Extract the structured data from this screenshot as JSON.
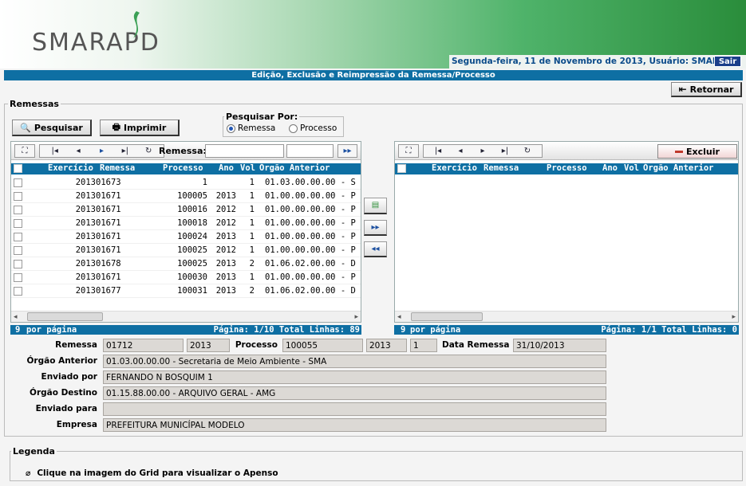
{
  "app": {
    "logo": "SMARAPD",
    "user_bar": "Segunda-feira, 11 de Novembro de 2013, Usuário: SMAR",
    "logout_label": "Sair",
    "title": "Edição, Exclusão e Reimpressão da Remessa/Processo",
    "return_label": "Retornar"
  },
  "remessas": {
    "legend": "Remessas",
    "search_label": "Pesquisar",
    "print_label": "Imprimir",
    "search_by": {
      "legend": "Pesquisar Por:",
      "options": [
        "Remessa",
        "Processo"
      ],
      "selected": "Remessa"
    }
  },
  "left_grid": {
    "remessa_label": "Remessa:",
    "nav_icons": [
      "first-icon",
      "prev-icon",
      "next-icon",
      "last-icon",
      "refresh-icon"
    ],
    "columns": [
      "Exercício",
      "Remessa",
      "Processo",
      "Ano",
      "Vol",
      "Órgão Anterior"
    ],
    "rows": [
      [
        "2013",
        "01673",
        "1",
        "",
        "1",
        "01.03.00.00.00 - S"
      ],
      [
        "2013",
        "01671",
        "100005",
        "2013",
        "1",
        "01.00.00.00.00 - P"
      ],
      [
        "2013",
        "01671",
        "100016",
        "2012",
        "1",
        "01.00.00.00.00 - P"
      ],
      [
        "2013",
        "01671",
        "100018",
        "2012",
        "1",
        "01.00.00.00.00 - P"
      ],
      [
        "2013",
        "01671",
        "100024",
        "2013",
        "1",
        "01.00.00.00.00 - P"
      ],
      [
        "2013",
        "01671",
        "100025",
        "2012",
        "1",
        "01.00.00.00.00 - P"
      ],
      [
        "2013",
        "01678",
        "100025",
        "2013",
        "2",
        "01.06.02.00.00 - D"
      ],
      [
        "2013",
        "01671",
        "100030",
        "2013",
        "1",
        "01.00.00.00.00 - P"
      ],
      [
        "2013",
        "01677",
        "100031",
        "2013",
        "2",
        "01.06.02.00.00 - D"
      ]
    ],
    "per_page": "9",
    "per_page_label": "por página",
    "page_info": "Página: 1/10 Total Linhas: 89"
  },
  "right_grid": {
    "delete_label": "Excluir",
    "columns": [
      "Exercício",
      "Remessa",
      "Processo",
      "Ano",
      "Vol",
      "Órgão Anterior"
    ],
    "per_page": "9",
    "per_page_label": "por página",
    "page_info": "Página: 1/1 Total Linhas: 0"
  },
  "details": {
    "remessa_label": "Remessa",
    "remessa": "01712",
    "remessa_ano": "2013",
    "processo_label": "Processo",
    "processo": "100055",
    "processo_ano": "2013",
    "processo_vol": "1",
    "data_remessa_label": "Data Remessa",
    "data_remessa": "31/10/2013",
    "orgao_anterior_label": "Órgão Anterior",
    "orgao_anterior": "01.03.00.00.00 - Secretaria de Meio Ambiente - SMA",
    "enviado_por_label": "Enviado por",
    "enviado_por": "FERNANDO N BOSQUIM 1",
    "orgao_destino_label": "Órgão Destino",
    "orgao_destino": "01.15.88.00.00 - ARQUIVO GERAL - AMG",
    "enviado_para_label": "Enviado para",
    "enviado_para": "",
    "empresa_label": "Empresa",
    "empresa": "PREFEITURA MUNICÍPAL MODELO"
  },
  "legenda": {
    "legend": "Legenda",
    "text": "Clique na imagem do Grid para visualizar o Apenso"
  },
  "colors": {
    "header_blue": "#0e6fa3",
    "brand_green": "#2a8d3b",
    "delete_red": "#c0392b"
  }
}
